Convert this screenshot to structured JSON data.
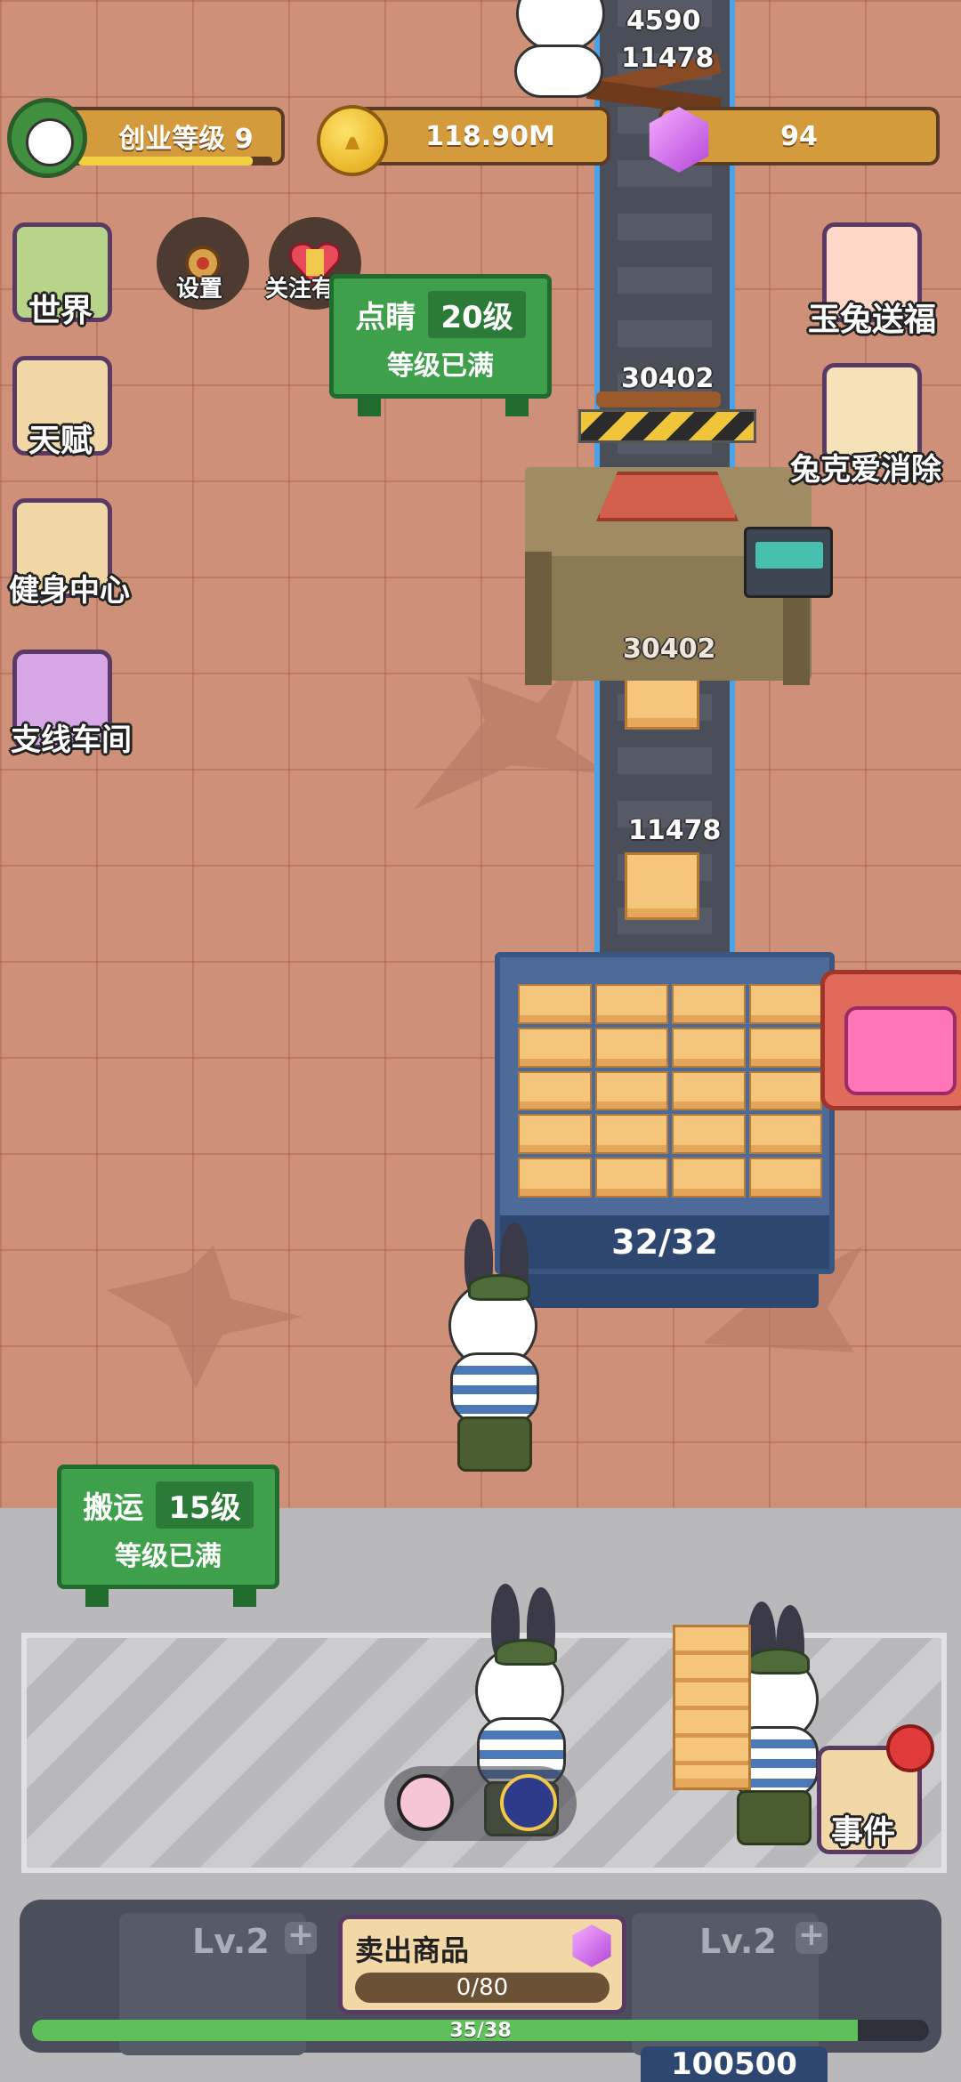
{
  "header": {
    "level_label": "创业等级 9",
    "level_progress": 0.9,
    "coins": "118.90M",
    "gems": "94"
  },
  "left_menu": [
    {
      "id": "world",
      "label": "世界",
      "icon": "map-icon"
    },
    {
      "id": "talent",
      "label": "天赋",
      "icon": "rabbit-cap-icon"
    },
    {
      "id": "gym",
      "label": "健身中心",
      "icon": "dumbbell-rabbit-icon"
    },
    {
      "id": "branch",
      "label": "支线车间",
      "icon": "drink-rabbit-icon"
    }
  ],
  "top_round_buttons": [
    {
      "id": "settings",
      "label": "设置",
      "icon": "gear-icon"
    },
    {
      "id": "follow",
      "label": "关注有礼",
      "icon": "gift-heart-icon"
    }
  ],
  "right_menu": [
    {
      "id": "jade-rabbit",
      "label": "玉兔送福",
      "icon": "rabbit-gift-icon"
    },
    {
      "id": "match",
      "label": "兔克爱消除",
      "icon": "cards-icon"
    }
  ],
  "signs": {
    "upgrade_station": {
      "name": "点睛",
      "level": "20级",
      "status": "等级已满"
    },
    "carry_station": {
      "name": "搬运",
      "level": "15级",
      "status": "等级已满"
    }
  },
  "conveyor_labels": {
    "top_a": "4590",
    "top_b": "11478",
    "machine_in": "30402",
    "machine_out": "30402",
    "belt_box": "11478"
  },
  "storage": {
    "count": "32/32"
  },
  "bottom_bar": {
    "slot_left": "Lv.2",
    "slot_right": "Lv.2",
    "sell_title": "卖出商品",
    "sell_progress": "0/80",
    "xp_text": "35/38",
    "xp_fraction": 0.921,
    "bottom_coins": "100500"
  },
  "event_button": {
    "label": "事件"
  },
  "colors": {
    "floor": "#cf9079",
    "belt_edge": "#4aa3e8",
    "sign_green": "#3fa04c",
    "panel_dark": "#4a4f5b",
    "xp_green": "#5fbf5a"
  }
}
